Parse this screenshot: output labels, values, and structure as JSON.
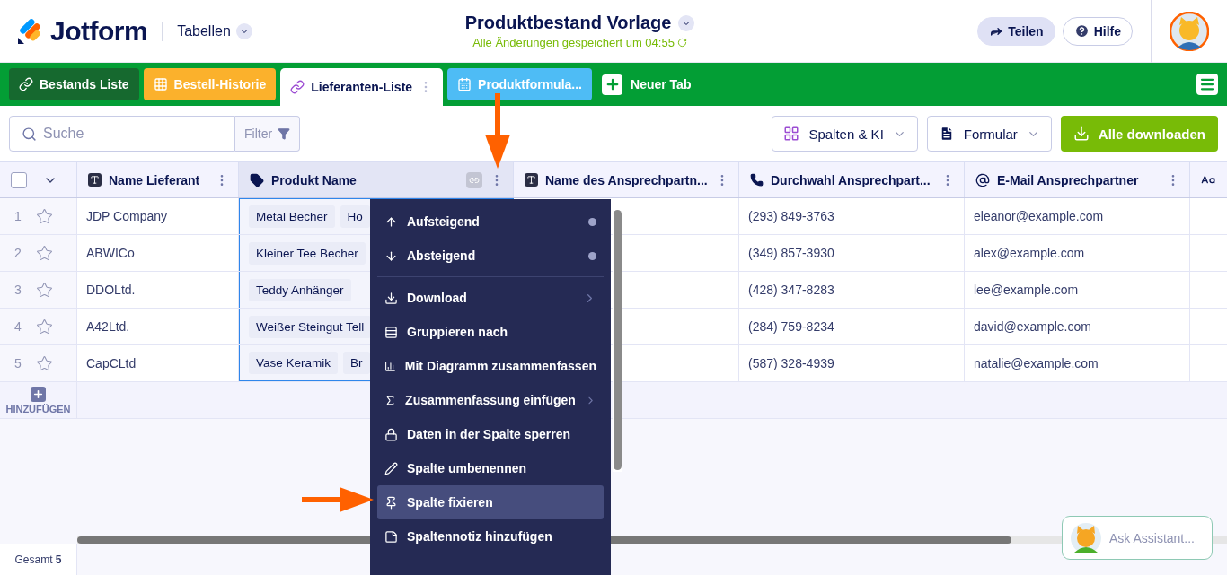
{
  "header": {
    "logo": "Jotform",
    "app_switcher": "Tabellen",
    "title": "Produktbestand Vorlage",
    "saved_status": "Alle Änderungen gespeichert um 04:55",
    "share": "Teilen",
    "help": "Hilfe"
  },
  "tabs": [
    {
      "label": "Bestands Liste",
      "kind": "link",
      "color": "#16692f",
      "selected": false
    },
    {
      "label": "Bestell-Historie",
      "kind": "grid",
      "color": "#fbb12c",
      "selected": false
    },
    {
      "label": "Lieferanten-Liste",
      "kind": "link",
      "color": "#ffffff",
      "selected": true
    },
    {
      "label": "Produktformula...",
      "kind": "calendar",
      "color": "#4ebcf5",
      "selected": false
    }
  ],
  "new_tab": "Neuer Tab",
  "toolbar": {
    "search_placeholder": "Suche",
    "filter": "Filter",
    "columns_ai": "Spalten & KI",
    "form": "Formular",
    "download_all": "Alle downloaden"
  },
  "table": {
    "header_checkbox": {
      "checked": false
    },
    "columns": [
      {
        "label": "Name Lieferant",
        "kind": "text",
        "selected": false
      },
      {
        "label": "Produkt Name",
        "kind": "tag",
        "selected": true
      },
      {
        "label": "Name des Ansprechpartn...",
        "kind": "text",
        "selected": false
      },
      {
        "label": "Durchwahl Ansprechpart...",
        "kind": "phone",
        "selected": false
      },
      {
        "label": "E-Mail Ansprechpartner",
        "kind": "email",
        "selected": false
      },
      {
        "kind": "longtext",
        "selected": false
      }
    ],
    "rows": [
      {
        "number": "1",
        "starred": false,
        "supplier": "JDP Company",
        "products": [
          "Metal Becher",
          "Ho"
        ],
        "phone": "(293) 849-3763",
        "email": "eleanor@example.com"
      },
      {
        "number": "2",
        "starred": false,
        "supplier": "ABWICo",
        "products": [
          "Kleiner Tee Becher"
        ],
        "phone": "(349) 857-3930",
        "email": "alex@example.com"
      },
      {
        "number": "3",
        "starred": false,
        "supplier": "DDOLtd.",
        "products": [
          "Teddy Anhänger"
        ],
        "phone": "(428) 347-8283",
        "email": "lee@example.com"
      },
      {
        "number": "4",
        "starred": false,
        "supplier": "A42Ltd.",
        "products": [
          "Weißer Steingut Tell"
        ],
        "phone": "(284) 759-8234",
        "email": "david@example.com"
      },
      {
        "number": "5",
        "starred": false,
        "supplier": "CapCLtd",
        "products": [
          "Vase Keramik",
          "Br"
        ],
        "phone": "(587) 328-4939",
        "email": "natalie@example.com"
      }
    ],
    "add_row": "HINZUFÜGEN"
  },
  "column_menu": {
    "groups": [
      [
        {
          "label": "Aufsteigend",
          "kind": "sort-up",
          "submenu": false,
          "dot": true,
          "selected": false
        },
        {
          "label": "Absteigend",
          "kind": "sort-down",
          "submenu": false,
          "dot": true,
          "selected": false
        }
      ],
      [
        {
          "label": "Download",
          "kind": "download",
          "submenu": true,
          "dot": false,
          "selected": false
        },
        {
          "label": "Gruppieren nach",
          "kind": "group",
          "submenu": false,
          "dot": false,
          "selected": false
        },
        {
          "label": "Mit Diagramm zusammenfassen",
          "kind": "chart",
          "submenu": false,
          "dot": false,
          "selected": false
        },
        {
          "label": "Zusammenfassung einfügen",
          "kind": "formula",
          "submenu": true,
          "dot": false,
          "selected": false
        },
        {
          "label": "Daten in der Spalte sperren",
          "kind": "lock",
          "submenu": false,
          "dot": false,
          "selected": false
        },
        {
          "label": "Spalte umbenennen",
          "kind": "pencil",
          "submenu": false,
          "dot": false,
          "selected": false
        },
        {
          "label": "Spalte fixieren",
          "kind": "pin",
          "submenu": false,
          "dot": false,
          "selected": true
        },
        {
          "label": "Spaltennotiz hinzufügen",
          "kind": "note",
          "submenu": false,
          "dot": false,
          "selected": false
        }
      ]
    ]
  },
  "footer": {
    "total": "Gesamt **5**"
  },
  "assistant": {
    "placeholder": "Ask Assistant..."
  }
}
